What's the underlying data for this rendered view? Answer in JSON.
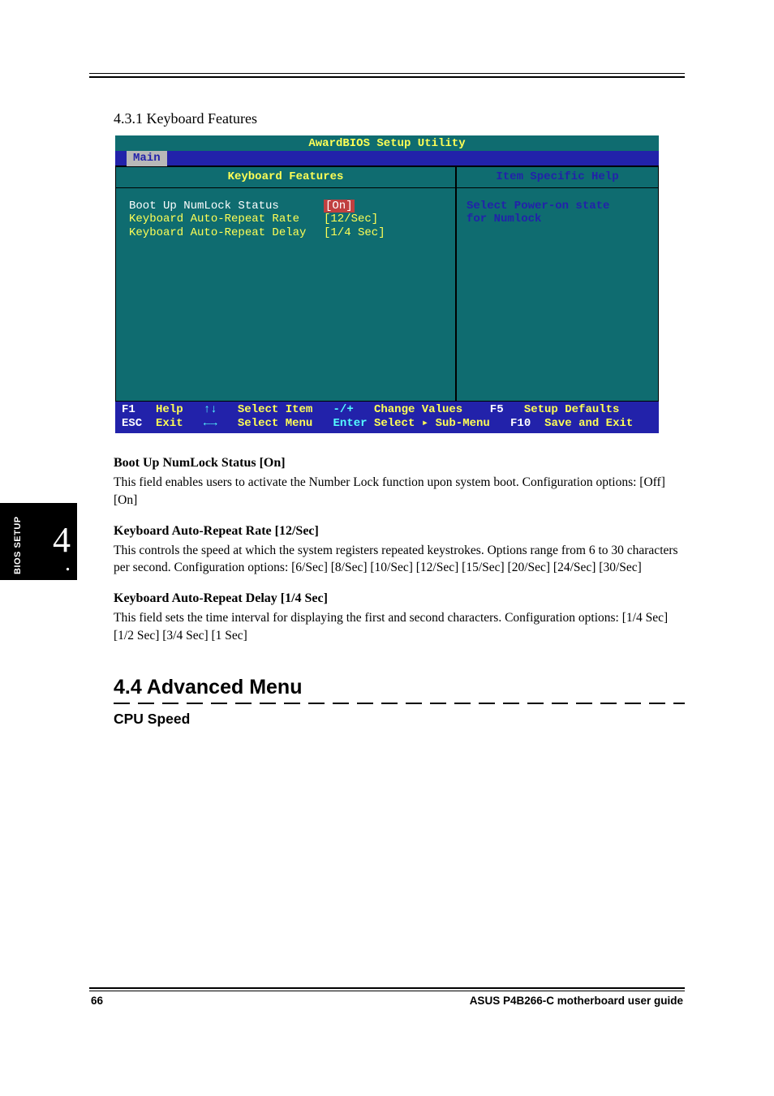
{
  "page": {
    "section_heading": "4.3.1 Keyboard Features",
    "footer_left": "66",
    "footer_right": "ASUS P4B266-C motherboard user guide"
  },
  "bios": {
    "title": "AwardBIOS Setup Utility",
    "tab": "Main",
    "left_title": "Keyboard Features",
    "right_title": "Item Specific Help",
    "help_line1": "Select Power-on state",
    "help_line2": "for Numlock",
    "items": [
      {
        "label": "Boot Up NumLock Status",
        "value": "[On]",
        "selected": true
      },
      {
        "label": "Keyboard Auto-Repeat Rate",
        "value": "[12/Sec]",
        "selected": false
      },
      {
        "label": "Keyboard Auto-Repeat Delay",
        "value": "[1/4 Sec]",
        "selected": false
      }
    ],
    "footer": {
      "r1": {
        "k1": "F1",
        "l1": "Help",
        "k2": "↑↓",
        "l2": "Select Item",
        "k3": "-/+",
        "l3": "Change Values",
        "k4": "F5",
        "l4": "Setup Defaults"
      },
      "r2": {
        "k1": "ESC",
        "l1": "Exit",
        "k2": "←→",
        "l2": "Select Menu",
        "k3": "Enter",
        "l3": "Select ▸ Sub-Menu",
        "k4": "F10",
        "l4": "Save and Exit"
      }
    }
  },
  "items": {
    "numlock_title": "Boot Up NumLock Status [On]",
    "numlock_body": "This field enables users to activate the Number Lock function upon system boot. Configuration options: [Off] [On]",
    "rate_title": "Keyboard Auto-Repeat Rate [12/Sec]",
    "rate_body": "This controls the speed at which the system registers repeated keystrokes. Options range from 6 to 30 characters per second. Configuration options: [6/Sec] [8/Sec] [10/Sec] [12/Sec] [15/Sec] [20/Sec] [24/Sec] [30/Sec]",
    "delay_title": "Keyboard Auto-Repeat Delay [1/4 Sec]",
    "delay_body": "This field sets the time interval for displaying the first and second characters. Configuration options: [1/4 Sec] [1/2 Sec] [3/4 Sec] [1 Sec]"
  },
  "side": {
    "label": "BIOS SETUP",
    "number": "4",
    "dot": "."
  },
  "advanced": {
    "heading": "4.4 Advanced Menu",
    "sub": "CPU Speed"
  }
}
